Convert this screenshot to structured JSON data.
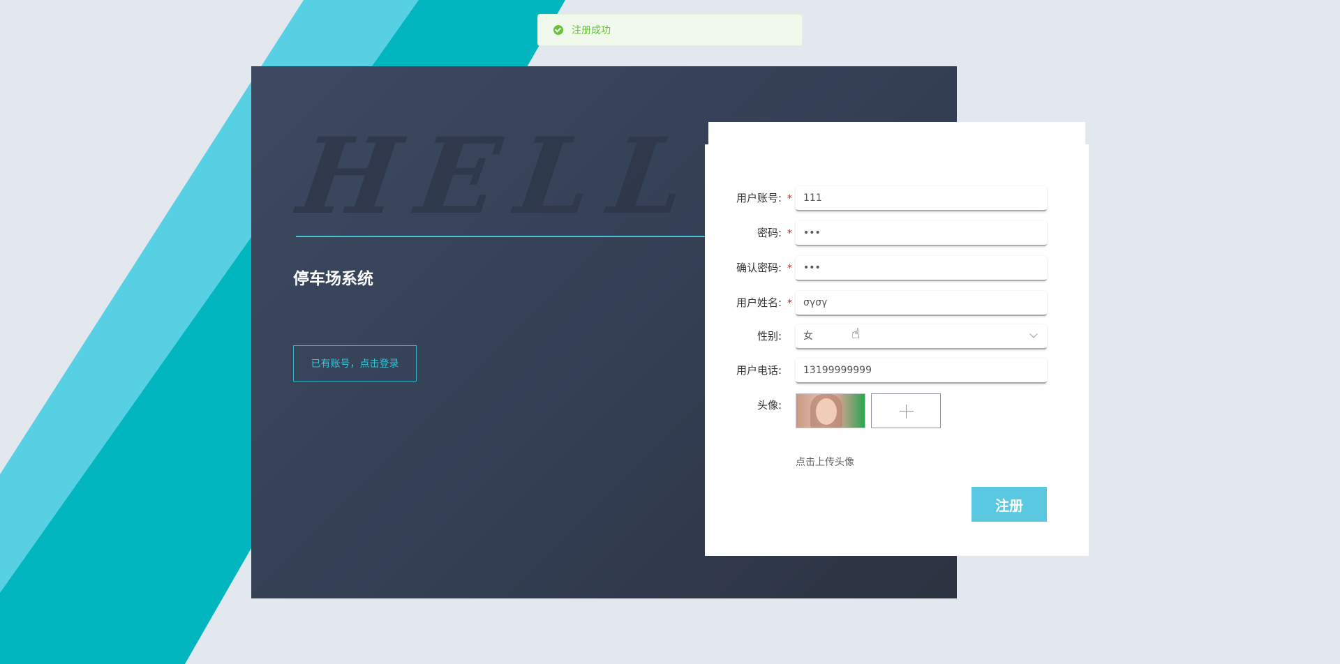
{
  "toast": {
    "message": "注册成功",
    "icon": "check-circle-icon",
    "color": "#67c23a"
  },
  "hero": {
    "background_word": "HELLO",
    "system_title": "停车场系统",
    "login_link_label": "已有账号，点击登录",
    "accent_color": "#4ec3d6"
  },
  "form": {
    "fields": [
      {
        "label": "用户账号:",
        "required": true,
        "value": "111"
      },
      {
        "label": "密码:",
        "required": true,
        "value": "•••"
      },
      {
        "label": "确认密码:",
        "required": true,
        "value": "•••"
      },
      {
        "label": "用户姓名:",
        "required": true,
        "value": "σγσγ"
      },
      {
        "label": "性别:",
        "required": false,
        "value": "女"
      },
      {
        "label": "用户电话:",
        "required": false,
        "value": "13199999999"
      }
    ],
    "required_mark": "*",
    "avatar_label": "头像:",
    "upload_hint": "点击上传头像",
    "submit_label": "注册",
    "submit_color": "#59c8e0"
  }
}
